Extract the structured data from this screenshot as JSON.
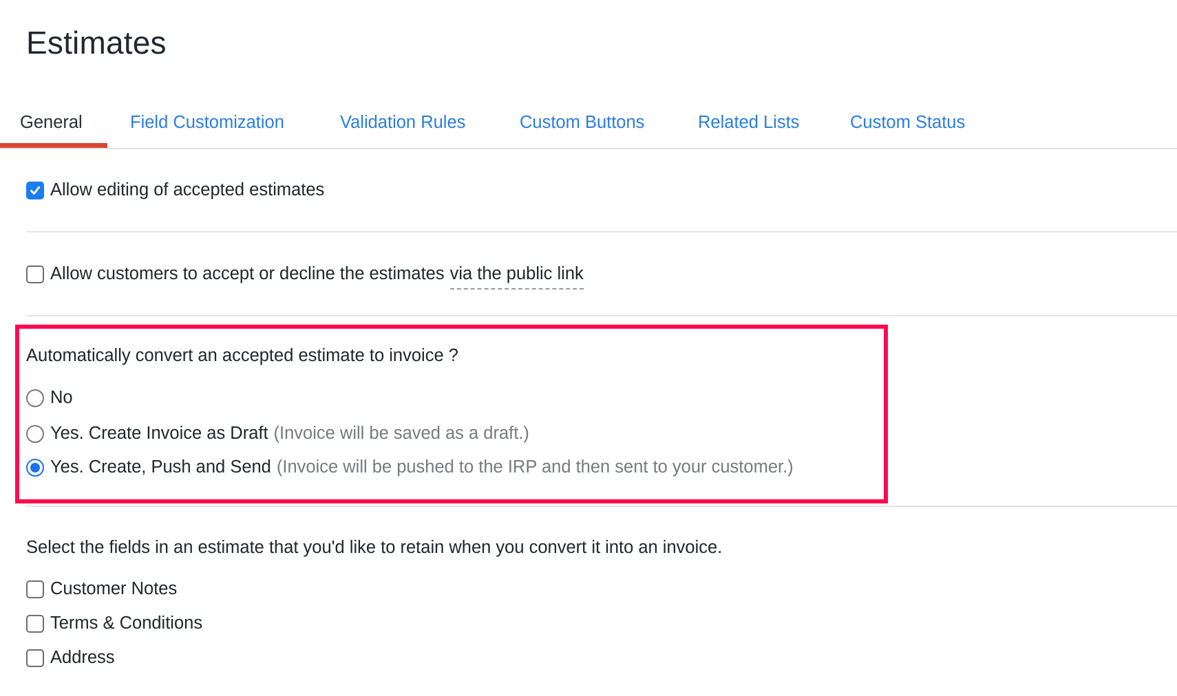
{
  "page": {
    "title": "Estimates"
  },
  "tabs": [
    {
      "label": "General",
      "active": true
    },
    {
      "label": "Field Customization",
      "active": false
    },
    {
      "label": "Validation Rules",
      "active": false
    },
    {
      "label": "Custom Buttons",
      "active": false
    },
    {
      "label": "Related Lists",
      "active": false
    },
    {
      "label": "Custom Status",
      "active": false
    }
  ],
  "colors": {
    "accent_blue": "#2a7de1",
    "active_tab_underline": "#d9472e",
    "highlight_border": "#ff0a50",
    "checked_control": "#1a73e8"
  },
  "settings": {
    "allow_editing": {
      "label": "Allow editing of accepted estimates",
      "checked": true
    },
    "allow_customers": {
      "label": "Allow customers to accept or decline the estimates",
      "link_text": "via the public link",
      "checked": false
    },
    "auto_convert": {
      "question": "Automatically convert an accepted estimate to invoice ?",
      "selected": "push_send",
      "options": [
        {
          "id": "no",
          "label": "No",
          "note": ""
        },
        {
          "id": "draft",
          "label": "Yes. Create Invoice as Draft",
          "note": "(Invoice will be saved as a draft.)"
        },
        {
          "id": "push_send",
          "label": "Yes. Create, Push and Send",
          "note": "(Invoice will be pushed to the IRP and then sent to your customer.)"
        }
      ]
    },
    "retain_fields": {
      "question": "Select the fields in an estimate that you'd like to retain when you convert it into an invoice.",
      "options": [
        {
          "label": "Customer Notes",
          "checked": false
        },
        {
          "label": "Terms & Conditions",
          "checked": false
        },
        {
          "label": "Address",
          "checked": false
        }
      ]
    }
  }
}
